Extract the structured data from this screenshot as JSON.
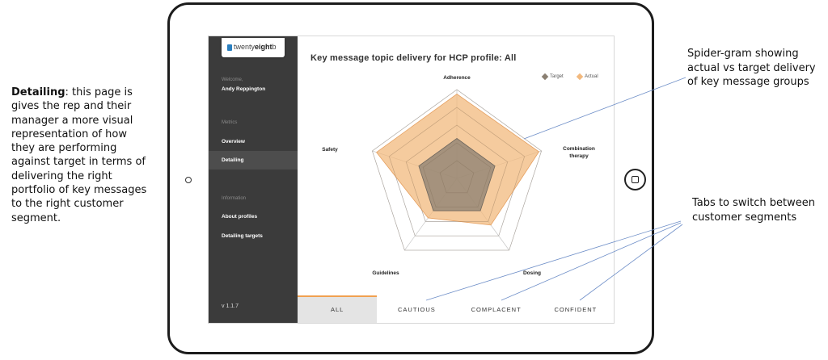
{
  "description": {
    "bold": "Detailing",
    "rest": ": this page is gives the rep and their manager a more visual representation of how they are performing against target in terms of delivering the right portfolio of key messages to the right customer segment."
  },
  "callouts": {
    "spider": "Spider-gram showing actual vs target delivery of key message groups",
    "tabs": "Tabs to switch between customer segments"
  },
  "app": {
    "logo_prefix": "twenty",
    "logo_bold": "eight",
    "logo_suffix": "b",
    "welcome_label": "Welcome,",
    "user_name": "Andy Reppington",
    "metrics_label": "Metrics",
    "metrics_items": [
      "Overview",
      "Detailing"
    ],
    "information_label": "Information",
    "information_items": [
      "About profiles",
      "Detailing targets"
    ],
    "version": "v 1.1.7"
  },
  "page_title": "Key message topic delivery for HCP profile: All",
  "legend": {
    "target": "Target",
    "actual": "Actual",
    "target_color": "#8a7f72",
    "actual_color": "#f2b97e"
  },
  "axes": [
    "Adherence",
    "Combination therapy",
    "Dosing",
    "Guidelines",
    "Safety"
  ],
  "tabs": [
    "ALL",
    "CAUTIOUS",
    "COMPLACENT",
    "CONFIDENT"
  ],
  "active_tab": "ALL",
  "accent_color": "#f0a050",
  "chart_data": {
    "type": "radar",
    "categories": [
      "Adherence",
      "Combination therapy",
      "Dosing",
      "Guidelines",
      "Safety"
    ],
    "rings": 5,
    "series": [
      {
        "name": "Target",
        "values": [
          0.45,
          0.45,
          0.45,
          0.45,
          0.45
        ]
      },
      {
        "name": "Actual",
        "values": [
          0.95,
          0.97,
          0.65,
          0.55,
          0.95
        ]
      }
    ],
    "max": 1
  }
}
